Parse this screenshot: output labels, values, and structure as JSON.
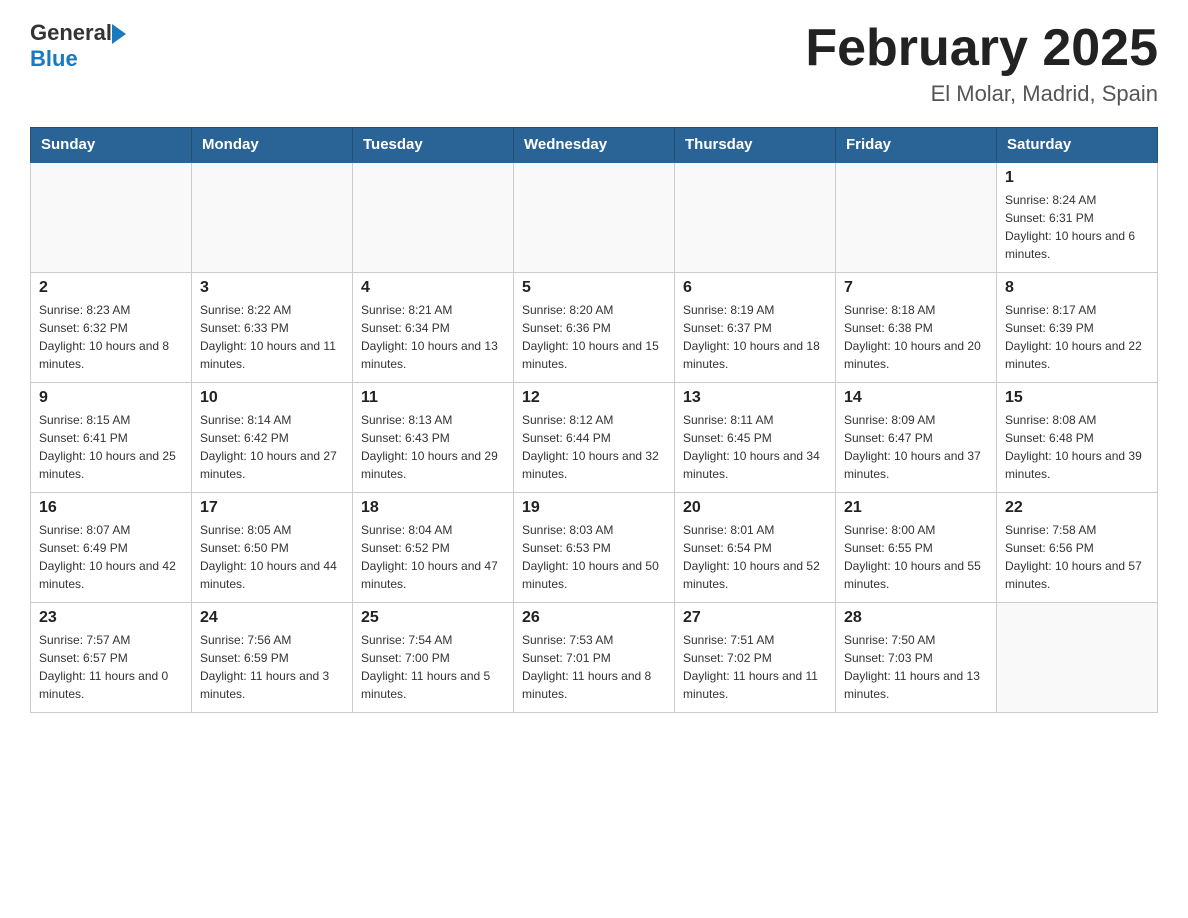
{
  "logo": {
    "text_general": "General",
    "text_blue": "Blue"
  },
  "title": "February 2025",
  "subtitle": "El Molar, Madrid, Spain",
  "days_of_week": [
    "Sunday",
    "Monday",
    "Tuesday",
    "Wednesday",
    "Thursday",
    "Friday",
    "Saturday"
  ],
  "weeks": [
    [
      {
        "day": "",
        "info": ""
      },
      {
        "day": "",
        "info": ""
      },
      {
        "day": "",
        "info": ""
      },
      {
        "day": "",
        "info": ""
      },
      {
        "day": "",
        "info": ""
      },
      {
        "day": "",
        "info": ""
      },
      {
        "day": "1",
        "info": "Sunrise: 8:24 AM\nSunset: 6:31 PM\nDaylight: 10 hours and 6 minutes."
      }
    ],
    [
      {
        "day": "2",
        "info": "Sunrise: 8:23 AM\nSunset: 6:32 PM\nDaylight: 10 hours and 8 minutes."
      },
      {
        "day": "3",
        "info": "Sunrise: 8:22 AM\nSunset: 6:33 PM\nDaylight: 10 hours and 11 minutes."
      },
      {
        "day": "4",
        "info": "Sunrise: 8:21 AM\nSunset: 6:34 PM\nDaylight: 10 hours and 13 minutes."
      },
      {
        "day": "5",
        "info": "Sunrise: 8:20 AM\nSunset: 6:36 PM\nDaylight: 10 hours and 15 minutes."
      },
      {
        "day": "6",
        "info": "Sunrise: 8:19 AM\nSunset: 6:37 PM\nDaylight: 10 hours and 18 minutes."
      },
      {
        "day": "7",
        "info": "Sunrise: 8:18 AM\nSunset: 6:38 PM\nDaylight: 10 hours and 20 minutes."
      },
      {
        "day": "8",
        "info": "Sunrise: 8:17 AM\nSunset: 6:39 PM\nDaylight: 10 hours and 22 minutes."
      }
    ],
    [
      {
        "day": "9",
        "info": "Sunrise: 8:15 AM\nSunset: 6:41 PM\nDaylight: 10 hours and 25 minutes."
      },
      {
        "day": "10",
        "info": "Sunrise: 8:14 AM\nSunset: 6:42 PM\nDaylight: 10 hours and 27 minutes."
      },
      {
        "day": "11",
        "info": "Sunrise: 8:13 AM\nSunset: 6:43 PM\nDaylight: 10 hours and 29 minutes."
      },
      {
        "day": "12",
        "info": "Sunrise: 8:12 AM\nSunset: 6:44 PM\nDaylight: 10 hours and 32 minutes."
      },
      {
        "day": "13",
        "info": "Sunrise: 8:11 AM\nSunset: 6:45 PM\nDaylight: 10 hours and 34 minutes."
      },
      {
        "day": "14",
        "info": "Sunrise: 8:09 AM\nSunset: 6:47 PM\nDaylight: 10 hours and 37 minutes."
      },
      {
        "day": "15",
        "info": "Sunrise: 8:08 AM\nSunset: 6:48 PM\nDaylight: 10 hours and 39 minutes."
      }
    ],
    [
      {
        "day": "16",
        "info": "Sunrise: 8:07 AM\nSunset: 6:49 PM\nDaylight: 10 hours and 42 minutes."
      },
      {
        "day": "17",
        "info": "Sunrise: 8:05 AM\nSunset: 6:50 PM\nDaylight: 10 hours and 44 minutes."
      },
      {
        "day": "18",
        "info": "Sunrise: 8:04 AM\nSunset: 6:52 PM\nDaylight: 10 hours and 47 minutes."
      },
      {
        "day": "19",
        "info": "Sunrise: 8:03 AM\nSunset: 6:53 PM\nDaylight: 10 hours and 50 minutes."
      },
      {
        "day": "20",
        "info": "Sunrise: 8:01 AM\nSunset: 6:54 PM\nDaylight: 10 hours and 52 minutes."
      },
      {
        "day": "21",
        "info": "Sunrise: 8:00 AM\nSunset: 6:55 PM\nDaylight: 10 hours and 55 minutes."
      },
      {
        "day": "22",
        "info": "Sunrise: 7:58 AM\nSunset: 6:56 PM\nDaylight: 10 hours and 57 minutes."
      }
    ],
    [
      {
        "day": "23",
        "info": "Sunrise: 7:57 AM\nSunset: 6:57 PM\nDaylight: 11 hours and 0 minutes."
      },
      {
        "day": "24",
        "info": "Sunrise: 7:56 AM\nSunset: 6:59 PM\nDaylight: 11 hours and 3 minutes."
      },
      {
        "day": "25",
        "info": "Sunrise: 7:54 AM\nSunset: 7:00 PM\nDaylight: 11 hours and 5 minutes."
      },
      {
        "day": "26",
        "info": "Sunrise: 7:53 AM\nSunset: 7:01 PM\nDaylight: 11 hours and 8 minutes."
      },
      {
        "day": "27",
        "info": "Sunrise: 7:51 AM\nSunset: 7:02 PM\nDaylight: 11 hours and 11 minutes."
      },
      {
        "day": "28",
        "info": "Sunrise: 7:50 AM\nSunset: 7:03 PM\nDaylight: 11 hours and 13 minutes."
      },
      {
        "day": "",
        "info": ""
      }
    ]
  ]
}
